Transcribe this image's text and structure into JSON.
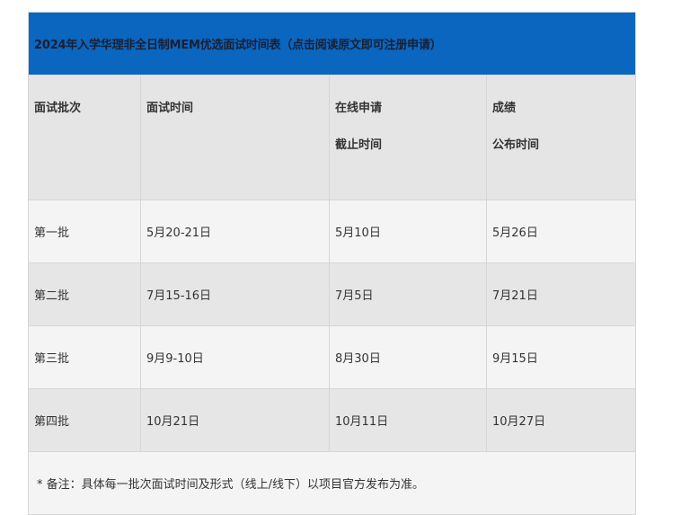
{
  "table": {
    "title": "2024年入学华理非全日制MEM优选面试时间表（点击阅读原文即可注册申请）",
    "headers": [
      {
        "line1": "面试批次",
        "line2": ""
      },
      {
        "line1": "面试时间",
        "line2": ""
      },
      {
        "line1": "在线申请",
        "line2": "截止时间"
      },
      {
        "line1": "成绩",
        "line2": "公布时间"
      }
    ],
    "rows": [
      [
        "第一批",
        "5月20-21日",
        "5月10日",
        "5月26日"
      ],
      [
        "第二批",
        "7月15-16日",
        "7月5日",
        "7月21日"
      ],
      [
        "第三批",
        "9月9-10日",
        "8月30日",
        "9月15日"
      ],
      [
        "第四批",
        "10月21日",
        "10月11日",
        "10月27日"
      ]
    ],
    "note": "* 备注：具体每一批次面试时间及形式（线上/线下）以项目官方发布为准。"
  },
  "colors": {
    "title_background": "#0a66be",
    "header_background": "#e5e5e5",
    "row_light": "#f4f4f4",
    "row_dark": "#e6e6e6"
  }
}
